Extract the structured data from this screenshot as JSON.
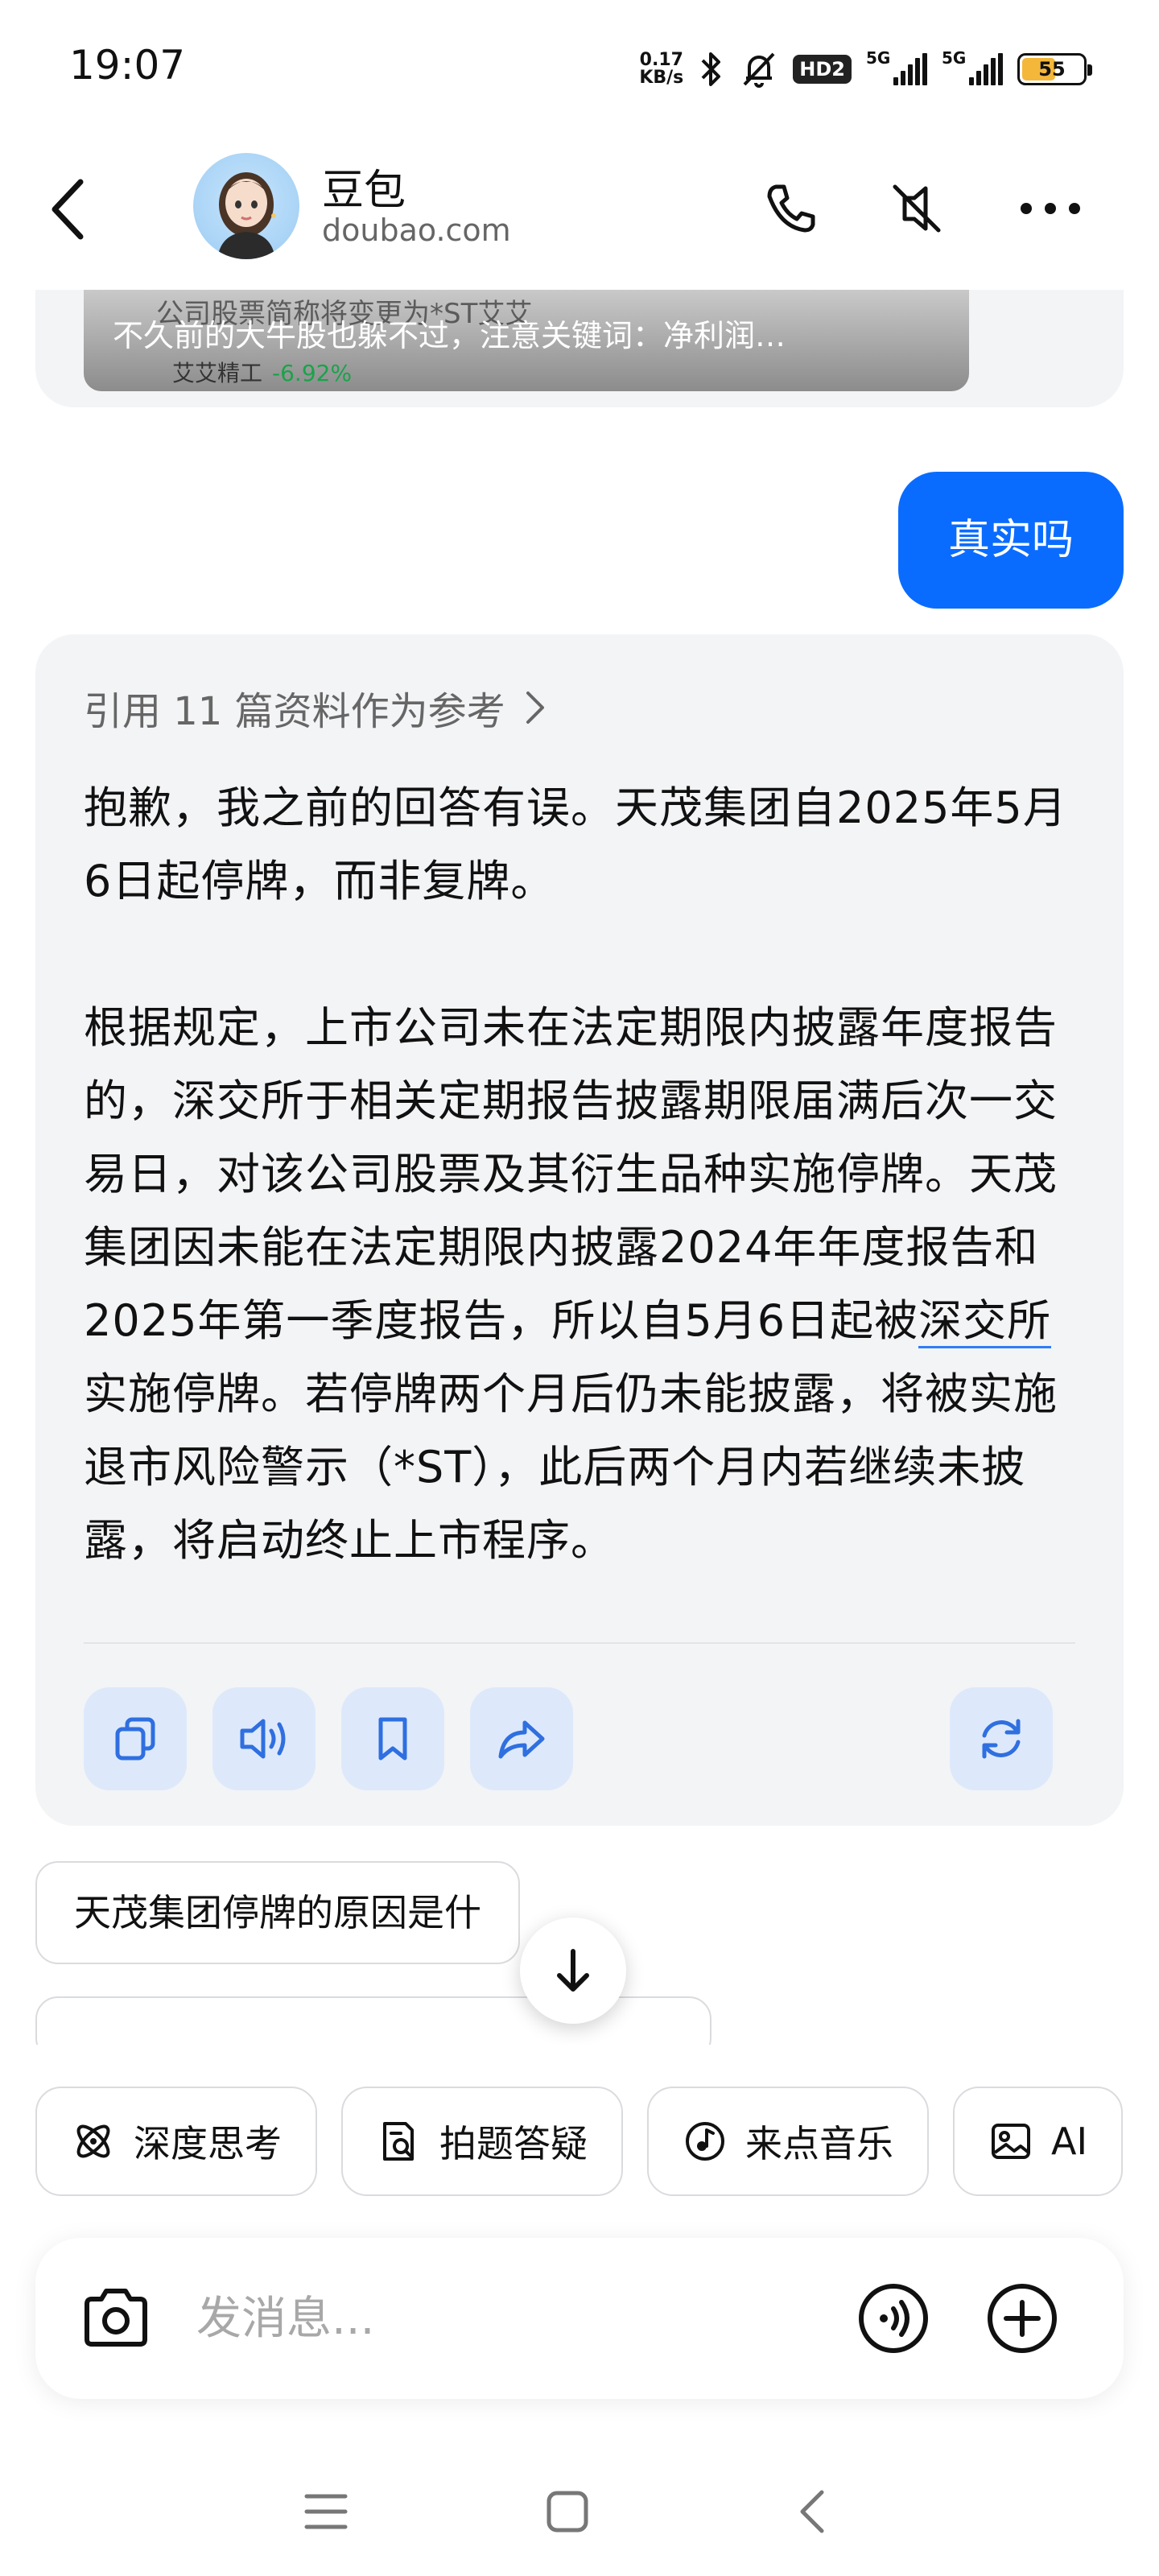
{
  "status_bar": {
    "time": "19:07",
    "net_speed_value": "0.17",
    "net_speed_unit": "KB/s",
    "hd_badge": "HD2",
    "sim1_label": "5G",
    "sim2_label": "5G",
    "battery_level": "55",
    "battery_fraction": 0.55
  },
  "header": {
    "bot_name": "豆包",
    "bot_domain": "doubao.com"
  },
  "chat": {
    "previous_card": {
      "news_underlay": "公司股票简称将变更为*ST艾艾",
      "news_caption": "不久前的大牛股也躲不过，注意关键词：净利润…",
      "stock_name": "艾艾精工",
      "stock_change": "-6.92%"
    },
    "user_message": "真实吗",
    "reply": {
      "reference_label": "引用 11 篇资料作为参考",
      "paragraph1": "抱歉，我之前的回答有误。天茂集团自2025年5月6日起停牌，而非复牌。",
      "paragraph2_part1": "根据规定，上市公司未在法定期限内披露年度报告的，深交所于相关定期报告披露期限届满后次一交易日，对该公司股票及其衍生品种实施停牌。天茂集团因未能在法定期限内披露2024年年度报告和2025年第一季度报告，所以自5月6日起被",
      "paragraph2_link": "深交所",
      "paragraph2_part2": "实施停牌。若停牌两个月后仍未能披露，将被实施退市风险警示（*ST），此后两个月内若继续未披露，将启动终止上市程序。"
    },
    "suggestion": "天茂集团停牌的原因是什"
  },
  "features": [
    {
      "label": "深度思考",
      "icon": "atom-icon"
    },
    {
      "label": "拍题答疑",
      "icon": "photo-question-icon"
    },
    {
      "label": "来点音乐",
      "icon": "music-icon"
    },
    {
      "label": "AI",
      "icon": "image-icon"
    }
  ],
  "input": {
    "placeholder": "发消息..."
  },
  "colors": {
    "accent": "#0a6cff",
    "card_bg": "#f3f4f6",
    "action_btn_bg": "#dde9fb",
    "stock_down": "#1aa34a",
    "battery": "#f4b73a"
  }
}
